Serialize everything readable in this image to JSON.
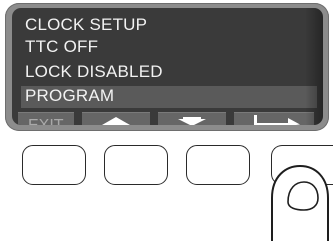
{
  "display": {
    "lines": [
      "CLOCK SETUP",
      "TTC OFF",
      "LOCK DISABLED",
      "PROGRAM"
    ],
    "selected_index": 3
  },
  "softkeys": [
    {
      "label": "EXIT",
      "icon": "exit-text"
    },
    {
      "label": "",
      "icon": "arrow-up-icon"
    },
    {
      "label": "",
      "icon": "arrow-down-icon"
    },
    {
      "label": "",
      "icon": "enter-return-icon"
    }
  ],
  "hardware_buttons": [
    "button-1",
    "button-2",
    "button-3",
    "button-4"
  ],
  "colors": {
    "bezel": "#8c8c8c",
    "screen": "#3a3a3a",
    "text": "#f2f2f2",
    "highlight": "#5a5a5a",
    "softkey": "#666666",
    "softkey_text": "#a9a9a9"
  }
}
